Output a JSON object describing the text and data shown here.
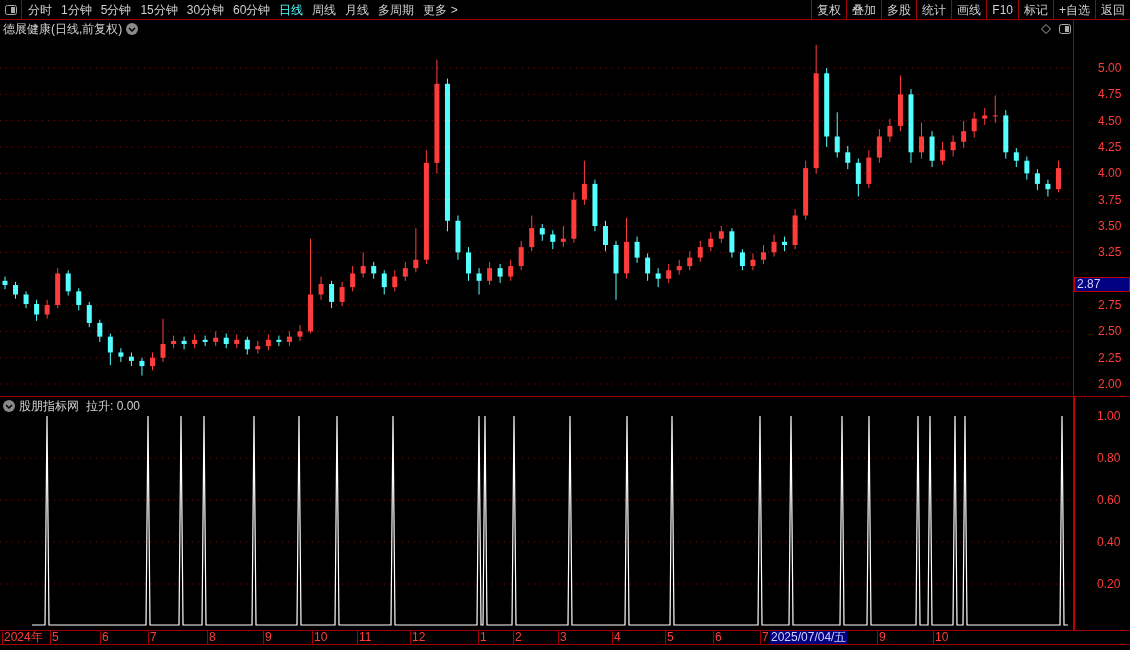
{
  "toolbar": {
    "periods": [
      {
        "label": "分时",
        "selected": false
      },
      {
        "label": "1分钟",
        "selected": false
      },
      {
        "label": "5分钟",
        "selected": false
      },
      {
        "label": "15分钟",
        "selected": false
      },
      {
        "label": "30分钟",
        "selected": false
      },
      {
        "label": "60分钟",
        "selected": false
      },
      {
        "label": "日线",
        "selected": true
      },
      {
        "label": "周线",
        "selected": false
      },
      {
        "label": "月线",
        "selected": false
      },
      {
        "label": "多周期",
        "selected": false
      }
    ],
    "more": "更多 >",
    "actions": [
      "复权",
      "叠加",
      "多股",
      "统计",
      "画线",
      "F10",
      "标记",
      "+自选",
      "返回"
    ]
  },
  "price_pane": {
    "title": "德展健康(日线,前复权)",
    "current_price": "2.87",
    "chart_data": {
      "type": "candlestick",
      "ylim": [
        1.877,
        5.456
      ],
      "grid": true,
      "yticks": [
        {
          "value": 5.0,
          "label": "5.00"
        },
        {
          "value": 4.75,
          "label": "4.75"
        },
        {
          "value": 4.5,
          "label": "4.50"
        },
        {
          "value": 4.25,
          "label": "4.25"
        },
        {
          "value": 4.0,
          "label": "4.00"
        },
        {
          "value": 3.75,
          "label": "3.75"
        },
        {
          "value": 3.5,
          "label": "3.50"
        },
        {
          "value": 3.25,
          "label": "3.25"
        },
        {
          "value": 2.75,
          "label": "2.75"
        },
        {
          "value": 2.5,
          "label": "2.50"
        },
        {
          "value": 2.25,
          "label": "2.25"
        },
        {
          "value": 2.0,
          "label": "2.00"
        }
      ],
      "categories": [
        null,
        null,
        null,
        null,
        null,
        null,
        null,
        null,
        null,
        null,
        null,
        null,
        null,
        null,
        null,
        null,
        null,
        null,
        null,
        null,
        null,
        null,
        null,
        null,
        null,
        null,
        null,
        null,
        null,
        null,
        null,
        null,
        null,
        null,
        null,
        null,
        null,
        null,
        null,
        null,
        null,
        null,
        null,
        null,
        null,
        null,
        null,
        null,
        null,
        null,
        null,
        null,
        null,
        null,
        null,
        null,
        null,
        null,
        null,
        null,
        null,
        null,
        null,
        null,
        null,
        null,
        null,
        null,
        null,
        null,
        null,
        null,
        null,
        null,
        null,
        null,
        null,
        null,
        null,
        null,
        null,
        null,
        null,
        null,
        null,
        null,
        null,
        null,
        null,
        null,
        null,
        null,
        null,
        null,
        null,
        null,
        null,
        null,
        null,
        null,
        null
      ],
      "ohlc": [
        [
          2.98,
          3.02,
          2.9,
          2.94
        ],
        [
          2.94,
          2.97,
          2.81,
          2.85
        ],
        [
          2.85,
          2.88,
          2.72,
          2.76
        ],
        [
          2.76,
          2.8,
          2.6,
          2.66
        ],
        [
          2.66,
          2.8,
          2.62,
          2.75
        ],
        [
          2.75,
          3.1,
          2.72,
          3.05
        ],
        [
          3.05,
          3.08,
          2.84,
          2.88
        ],
        [
          2.88,
          2.91,
          2.7,
          2.75
        ],
        [
          2.75,
          2.78,
          2.54,
          2.58
        ],
        [
          2.58,
          2.61,
          2.4,
          2.45
        ],
        [
          2.45,
          2.48,
          2.18,
          2.3
        ],
        [
          2.3,
          2.34,
          2.21,
          2.26
        ],
        [
          2.26,
          2.3,
          2.17,
          2.22
        ],
        [
          2.22,
          2.25,
          2.08,
          2.17
        ],
        [
          2.17,
          2.3,
          2.13,
          2.25
        ],
        [
          2.25,
          2.62,
          2.21,
          2.38
        ],
        [
          2.38,
          2.46,
          2.34,
          2.41
        ],
        [
          2.41,
          2.45,
          2.33,
          2.38
        ],
        [
          2.38,
          2.47,
          2.34,
          2.42
        ],
        [
          2.42,
          2.46,
          2.36,
          2.4
        ],
        [
          2.4,
          2.5,
          2.36,
          2.44
        ],
        [
          2.44,
          2.48,
          2.34,
          2.38
        ],
        [
          2.38,
          2.47,
          2.34,
          2.42
        ],
        [
          2.42,
          2.45,
          2.28,
          2.33
        ],
        [
          2.33,
          2.41,
          2.29,
          2.36
        ],
        [
          2.36,
          2.47,
          2.32,
          2.42
        ],
        [
          2.42,
          2.46,
          2.36,
          2.4
        ],
        [
          2.4,
          2.5,
          2.36,
          2.45
        ],
        [
          2.45,
          2.56,
          2.41,
          2.5
        ],
        [
          2.5,
          3.38,
          2.48,
          2.85
        ],
        [
          2.85,
          3.02,
          2.8,
          2.95
        ],
        [
          2.95,
          2.98,
          2.72,
          2.78
        ],
        [
          2.78,
          2.97,
          2.74,
          2.92
        ],
        [
          2.92,
          3.12,
          2.88,
          3.05
        ],
        [
          3.05,
          3.25,
          3.01,
          3.12
        ],
        [
          3.12,
          3.16,
          3.0,
          3.05
        ],
        [
          3.05,
          3.08,
          2.85,
          2.92
        ],
        [
          2.92,
          3.08,
          2.88,
          3.02
        ],
        [
          3.02,
          3.16,
          2.98,
          3.1
        ],
        [
          3.1,
          3.48,
          3.06,
          3.18
        ],
        [
          3.18,
          4.22,
          3.14,
          4.1
        ],
        [
          4.1,
          5.08,
          4.0,
          4.85
        ],
        [
          4.85,
          4.9,
          3.45,
          3.55
        ],
        [
          3.55,
          3.6,
          3.18,
          3.25
        ],
        [
          3.25,
          3.3,
          2.98,
          3.05
        ],
        [
          3.05,
          3.1,
          2.85,
          2.98
        ],
        [
          2.98,
          3.16,
          2.94,
          3.1
        ],
        [
          3.1,
          3.14,
          2.96,
          3.02
        ],
        [
          3.02,
          3.18,
          2.98,
          3.12
        ],
        [
          3.12,
          3.36,
          3.08,
          3.3
        ],
        [
          3.3,
          3.6,
          3.26,
          3.48
        ],
        [
          3.48,
          3.52,
          3.36,
          3.42
        ],
        [
          3.42,
          3.46,
          3.28,
          3.35
        ],
        [
          3.35,
          3.5,
          3.3,
          3.38
        ],
        [
          3.38,
          3.82,
          3.34,
          3.75
        ],
        [
          3.75,
          4.12,
          3.7,
          3.9
        ],
        [
          3.9,
          3.94,
          3.45,
          3.5
        ],
        [
          3.5,
          3.55,
          3.26,
          3.32
        ],
        [
          3.32,
          3.36,
          2.8,
          3.05
        ],
        [
          3.05,
          3.58,
          3.0,
          3.35
        ],
        [
          3.35,
          3.4,
          3.15,
          3.2
        ],
        [
          3.2,
          3.24,
          2.98,
          3.05
        ],
        [
          3.05,
          3.1,
          2.92,
          3.0
        ],
        [
          3.0,
          3.14,
          2.96,
          3.08
        ],
        [
          3.08,
          3.18,
          3.04,
          3.12
        ],
        [
          3.12,
          3.26,
          3.08,
          3.2
        ],
        [
          3.2,
          3.36,
          3.16,
          3.3
        ],
        [
          3.3,
          3.44,
          3.26,
          3.38
        ],
        [
          3.38,
          3.5,
          3.34,
          3.45
        ],
        [
          3.45,
          3.48,
          3.2,
          3.25
        ],
        [
          3.25,
          3.28,
          3.08,
          3.12
        ],
        [
          3.12,
          3.24,
          3.08,
          3.18
        ],
        [
          3.18,
          3.32,
          3.14,
          3.25
        ],
        [
          3.25,
          3.42,
          3.21,
          3.35
        ],
        [
          3.35,
          3.4,
          3.26,
          3.32
        ],
        [
          3.32,
          3.66,
          3.28,
          3.6
        ],
        [
          3.6,
          4.12,
          3.56,
          4.05
        ],
        [
          4.05,
          5.22,
          4.0,
          4.95
        ],
        [
          4.95,
          5.0,
          4.25,
          4.35
        ],
        [
          4.35,
          4.58,
          4.15,
          4.2
        ],
        [
          4.2,
          4.26,
          4.04,
          4.1
        ],
        [
          4.1,
          4.14,
          3.78,
          3.9
        ],
        [
          3.9,
          4.22,
          3.86,
          4.15
        ],
        [
          4.15,
          4.42,
          4.1,
          4.35
        ],
        [
          4.35,
          4.52,
          4.3,
          4.45
        ],
        [
          4.45,
          4.93,
          4.4,
          4.75
        ],
        [
          4.75,
          4.8,
          4.1,
          4.2
        ],
        [
          4.2,
          4.48,
          4.14,
          4.35
        ],
        [
          4.35,
          4.4,
          4.06,
          4.12
        ],
        [
          4.12,
          4.3,
          4.08,
          4.22
        ],
        [
          4.22,
          4.36,
          4.16,
          4.3
        ],
        [
          4.3,
          4.5,
          4.24,
          4.4
        ],
        [
          4.4,
          4.58,
          4.34,
          4.52
        ],
        [
          4.52,
          4.62,
          4.46,
          4.55
        ],
        [
          4.55,
          4.74,
          4.48,
          4.55
        ],
        [
          4.55,
          4.6,
          4.14,
          4.2
        ],
        [
          4.2,
          4.24,
          4.06,
          4.12
        ],
        [
          4.12,
          4.16,
          3.94,
          4.0
        ],
        [
          4.0,
          4.04,
          3.84,
          3.9
        ],
        [
          3.9,
          3.94,
          3.78,
          3.85
        ],
        [
          3.85,
          4.12,
          3.82,
          4.05
        ]
      ]
    }
  },
  "indicator_pane": {
    "name": "股朋指标网",
    "reading": "拉升: 0.00",
    "ticks": [
      "1.00",
      "0.80",
      "0.60",
      "0.40",
      "0.20"
    ]
  },
  "date_axis": {
    "labels": [
      {
        "text": "2024年",
        "kind": "plain"
      },
      {
        "text": "5",
        "kind": "plain"
      },
      {
        "text": "6",
        "kind": "plain"
      },
      {
        "text": "7",
        "kind": "plain"
      },
      {
        "text": "8",
        "kind": "plain"
      },
      {
        "text": "9",
        "kind": "plain"
      },
      {
        "text": "10",
        "kind": "plain"
      },
      {
        "text": "11",
        "kind": "plain"
      },
      {
        "text": "12",
        "kind": "plain"
      },
      {
        "text": "1",
        "kind": "plain"
      },
      {
        "text": "2",
        "kind": "plain"
      },
      {
        "text": "3",
        "kind": "plain"
      },
      {
        "text": "4",
        "kind": "plain"
      },
      {
        "text": "5",
        "kind": "plain"
      },
      {
        "text": "6",
        "kind": "plain"
      },
      {
        "text": "7",
        "kind": "plain"
      },
      {
        "text": "2025/07/04/五",
        "kind": "cursor"
      },
      {
        "text": "9",
        "kind": "plain"
      },
      {
        "text": "10",
        "kind": "plain"
      }
    ]
  }
}
